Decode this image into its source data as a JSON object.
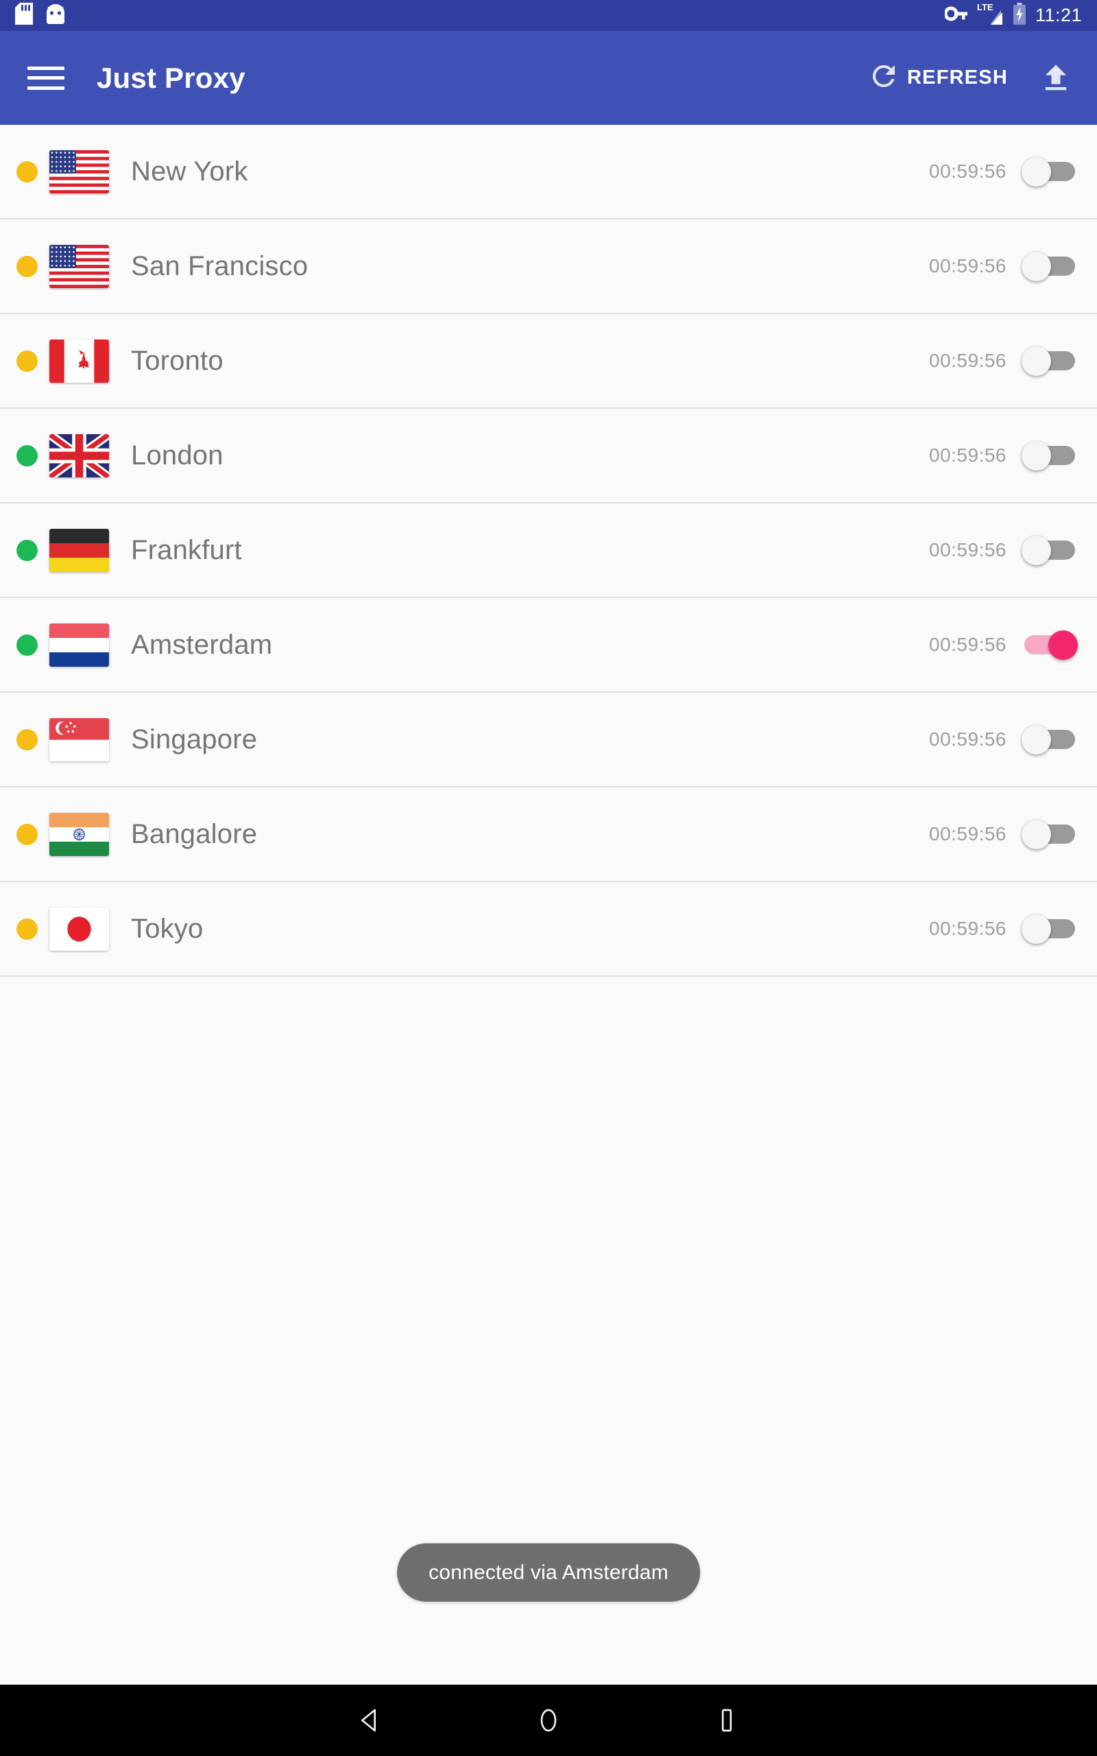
{
  "statusbar": {
    "time": "11:21",
    "icons": [
      "sd-card-icon",
      "android-icon",
      "vpn-key-icon",
      "lte-signal-icon",
      "battery-charging-icon"
    ],
    "network_label": "LTE",
    "background_color": "#303F9F"
  },
  "toolbar": {
    "title": "Just Proxy",
    "menu_icon": "hamburger-menu-icon",
    "refresh_label": "REFRESH",
    "refresh_icon": "refresh-icon",
    "upload_icon": "upload-arrow-icon",
    "background_color": "#3F51B5"
  },
  "colors": {
    "accent_on": "#F4246E",
    "accent_track": "#F9A8C4",
    "status_green": "#1DB954",
    "status_yellow": "#F6BD15",
    "track_off": "#9A9A9A",
    "text_primary": "#757575",
    "text_timer": "#9E9E9E"
  },
  "servers": [
    {
      "city": "New York",
      "flag": "us",
      "status": "yellow",
      "timer": "00:59:56",
      "enabled": false
    },
    {
      "city": "San Francisco",
      "flag": "us",
      "status": "yellow",
      "timer": "00:59:56",
      "enabled": false
    },
    {
      "city": "Toronto",
      "flag": "ca",
      "status": "yellow",
      "timer": "00:59:56",
      "enabled": false
    },
    {
      "city": "London",
      "flag": "gb",
      "status": "green",
      "timer": "00:59:56",
      "enabled": false
    },
    {
      "city": "Frankfurt",
      "flag": "de",
      "status": "green",
      "timer": "00:59:56",
      "enabled": false
    },
    {
      "city": "Amsterdam",
      "flag": "nl",
      "status": "green",
      "timer": "00:59:56",
      "enabled": true
    },
    {
      "city": "Singapore",
      "flag": "sg",
      "status": "yellow",
      "timer": "00:59:56",
      "enabled": false
    },
    {
      "city": "Bangalore",
      "flag": "in",
      "status": "yellow",
      "timer": "00:59:56",
      "enabled": false
    },
    {
      "city": "Tokyo",
      "flag": "jp",
      "status": "yellow",
      "timer": "00:59:56",
      "enabled": false
    }
  ],
  "toast": {
    "message": "connected via Amsterdam"
  },
  "navbar": {
    "back_icon": "back-triangle-icon",
    "home_icon": "home-circle-icon",
    "recents_icon": "recents-square-icon"
  }
}
